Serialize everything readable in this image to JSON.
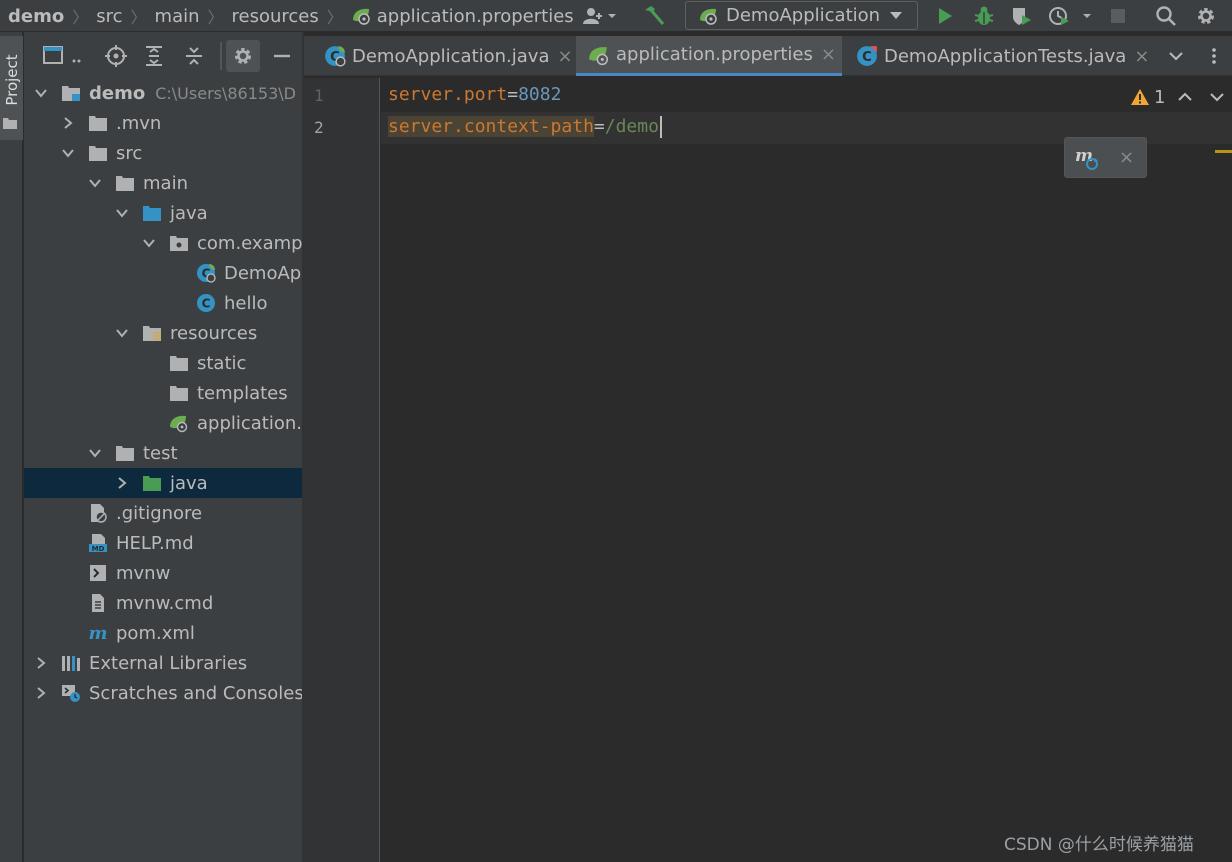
{
  "breadcrumbs": [
    "demo",
    "src",
    "main",
    "resources",
    "application.properties"
  ],
  "run_config": {
    "label": "DemoApplication"
  },
  "colors": {
    "selection": "#0d293e",
    "keyword": "#cc7832",
    "number": "#6897bb",
    "string": "#6a8759",
    "tab_active_underline": "#4a88c7",
    "run_green": "#499c54",
    "warning": "#f0a732"
  },
  "sidebar": {
    "project_tab": "Project"
  },
  "project_tree": {
    "root": {
      "name": "demo",
      "path": "C:\\Users\\86153\\D"
    },
    "items": [
      {
        "label": ".mvn",
        "icon": "folder-icon",
        "expanded": false
      },
      {
        "label": "src",
        "icon": "folder-icon",
        "expanded": true
      },
      {
        "label": "main",
        "icon": "folder-icon",
        "expanded": true
      },
      {
        "label": "java",
        "icon": "source-folder-icon",
        "expanded": true
      },
      {
        "label": "com.exampl",
        "icon": "package-icon",
        "expanded": true
      },
      {
        "label": "DemoAp",
        "icon": "spring-class-icon"
      },
      {
        "label": "hello",
        "icon": "class-icon"
      },
      {
        "label": "resources",
        "icon": "resources-folder-icon",
        "expanded": true
      },
      {
        "label": "static",
        "icon": "folder-icon"
      },
      {
        "label": "templates",
        "icon": "folder-icon"
      },
      {
        "label": "application.p",
        "icon": "spring-properties-icon"
      },
      {
        "label": "test",
        "icon": "folder-icon",
        "expanded": true
      },
      {
        "label": "java",
        "icon": "test-source-folder-icon",
        "expanded": false,
        "selected": true
      },
      {
        "label": ".gitignore",
        "icon": "ignore-file-icon"
      },
      {
        "label": "HELP.md",
        "icon": "markdown-file-icon"
      },
      {
        "label": "mvnw",
        "icon": "shell-script-icon"
      },
      {
        "label": "mvnw.cmd",
        "icon": "text-file-icon"
      },
      {
        "label": "pom.xml",
        "icon": "maven-icon"
      },
      {
        "label": "External Libraries",
        "icon": "libraries-icon",
        "expanded": false
      },
      {
        "label": "Scratches and Consoles",
        "icon": "scratches-icon",
        "expanded": false
      }
    ]
  },
  "tabs": [
    {
      "label": "DemoApplication.java",
      "icon": "spring-class-icon",
      "active": false
    },
    {
      "label": "application.properties",
      "icon": "spring-properties-icon",
      "active": true
    },
    {
      "label": "DemoApplicationTests.java",
      "icon": "test-class-icon",
      "active": false
    }
  ],
  "editor": {
    "lines": [
      {
        "number": "1",
        "key": "server.port",
        "eq": "=",
        "value": "8082"
      },
      {
        "number": "2",
        "key": "server.context-path",
        "eq": "=",
        "value": "/demo"
      }
    ],
    "warnings": "1"
  },
  "watermark": "CSDN @什么时候养猫猫"
}
